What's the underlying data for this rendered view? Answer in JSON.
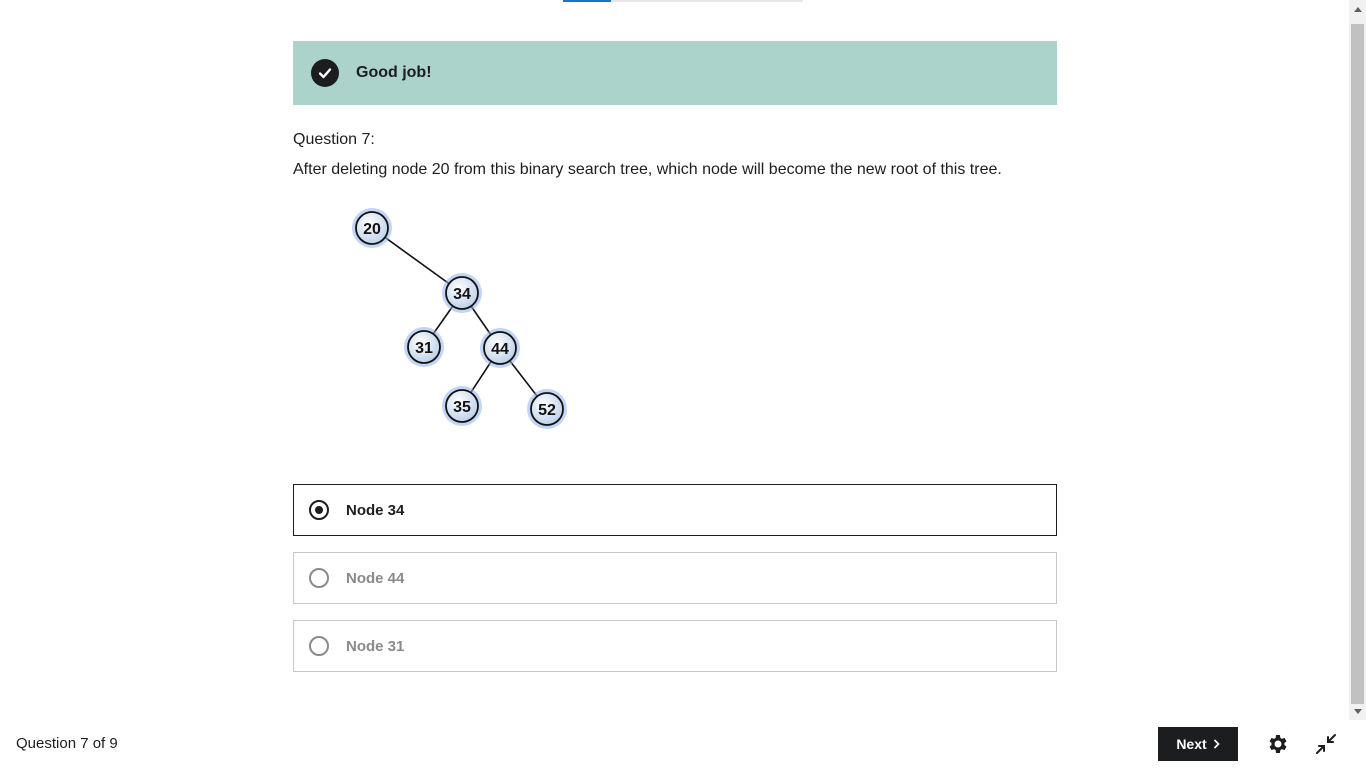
{
  "feedback": {
    "message": "Good job!",
    "icon": "check-circle-icon"
  },
  "question": {
    "number_label": "Question 7:",
    "text": "After deleting node 20 from this binary search tree, which node will become the new root of this tree."
  },
  "tree": {
    "nodes": [
      {
        "id": "n20",
        "label": "20"
      },
      {
        "id": "n34",
        "label": "34"
      },
      {
        "id": "n31",
        "label": "31"
      },
      {
        "id": "n44",
        "label": "44"
      },
      {
        "id": "n35",
        "label": "35"
      },
      {
        "id": "n52",
        "label": "52"
      }
    ],
    "edges": [
      [
        "n20",
        "n34"
      ],
      [
        "n34",
        "n31"
      ],
      [
        "n34",
        "n44"
      ],
      [
        "n44",
        "n35"
      ],
      [
        "n44",
        "n52"
      ]
    ]
  },
  "options": [
    {
      "label": "Node 34",
      "selected": true
    },
    {
      "label": "Node 44",
      "selected": false
    },
    {
      "label": "Node 31",
      "selected": false
    }
  ],
  "footer": {
    "progress_text": "Question 7 of 9",
    "next_label": "Next",
    "settings_icon": "gear-icon",
    "collapse_icon": "collapse-icon"
  },
  "colors": {
    "banner": "#acd2cc",
    "button": "#1c1d1f",
    "node_fill": "#d6e6f7",
    "node_glow": "#8fb3ee"
  }
}
